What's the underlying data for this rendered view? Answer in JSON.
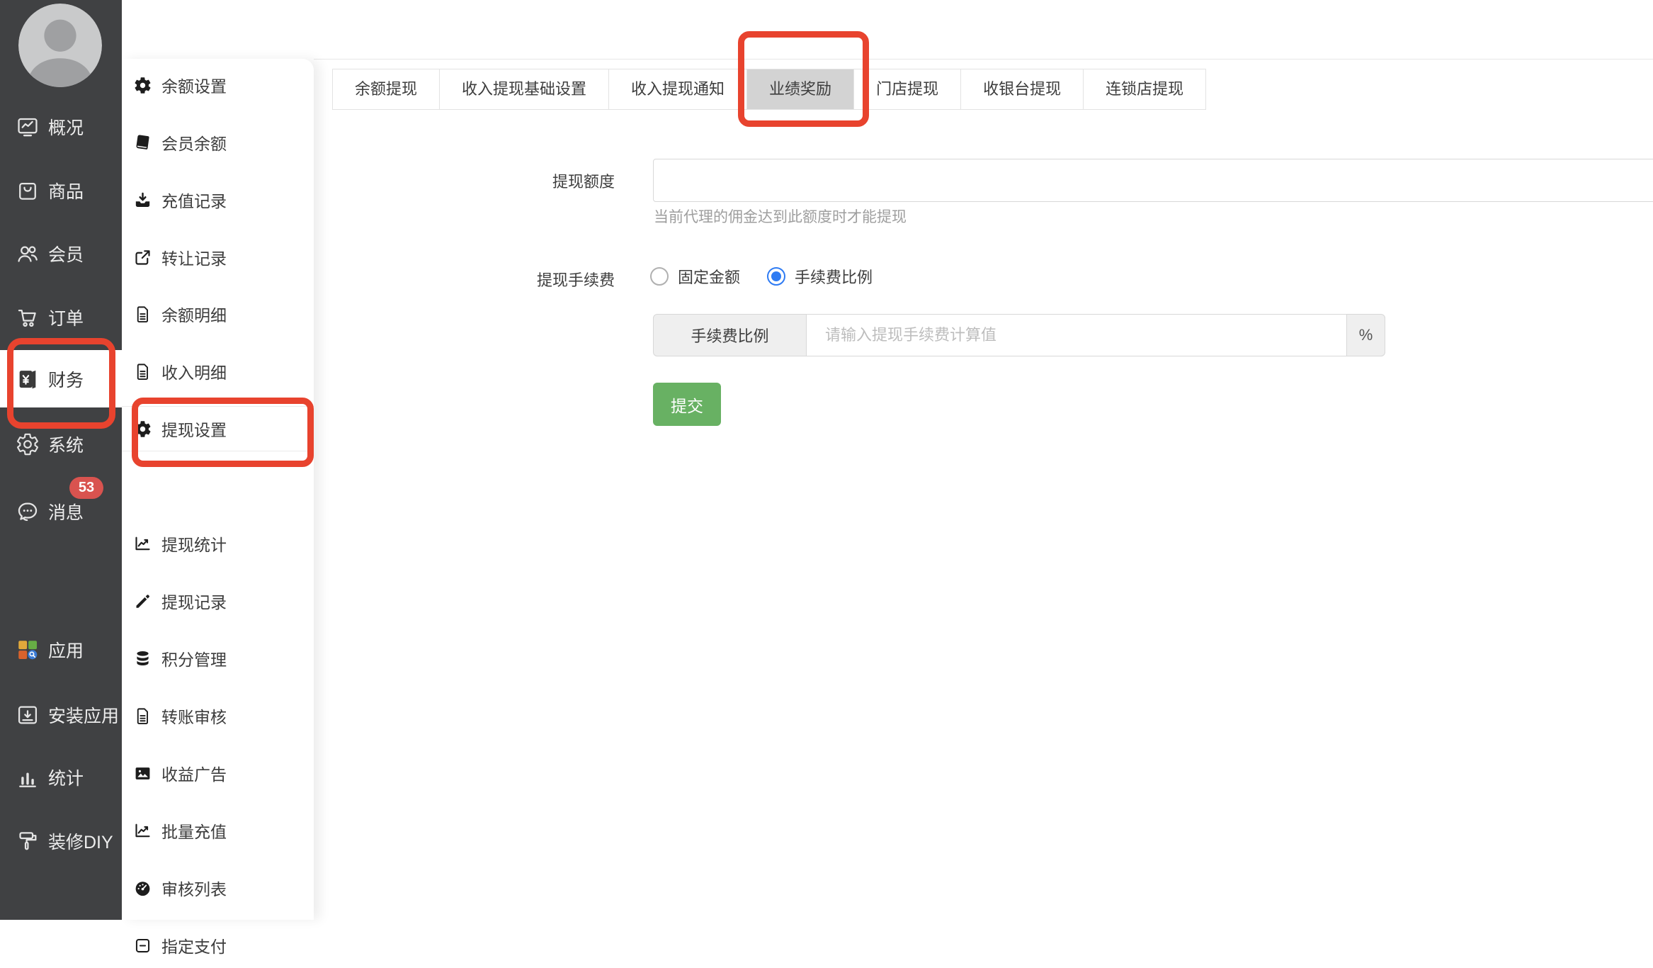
{
  "primary_sidebar": {
    "items": [
      {
        "label": "概况"
      },
      {
        "label": "商品"
      },
      {
        "label": "会员"
      },
      {
        "label": "订单"
      },
      {
        "label": "财务"
      },
      {
        "label": "系统"
      },
      {
        "label": "消息",
        "badge": "53"
      },
      {
        "label": "应用"
      },
      {
        "label": "安装应用"
      },
      {
        "label": "统计"
      },
      {
        "label": "装修DIY"
      }
    ]
  },
  "secondary_sidebar": {
    "items": [
      {
        "label": "余额设置"
      },
      {
        "label": "会员余额"
      },
      {
        "label": "充值记录"
      },
      {
        "label": "转让记录"
      },
      {
        "label": "余额明细"
      },
      {
        "label": "收入明细"
      },
      {
        "label": "提现设置"
      },
      {
        "label": "提现统计"
      },
      {
        "label": "提现记录"
      },
      {
        "label": "积分管理"
      },
      {
        "label": "转账审核"
      },
      {
        "label": "收益广告"
      },
      {
        "label": "批量充值"
      },
      {
        "label": "审核列表"
      },
      {
        "label": "指定支付"
      }
    ]
  },
  "tabs": {
    "items": [
      {
        "label": "余额提现",
        "active": false
      },
      {
        "label": "收入提现基础设置",
        "active": false
      },
      {
        "label": "收入提现通知",
        "active": false
      },
      {
        "label": "业绩奖励",
        "active": true
      },
      {
        "label": "门店提现",
        "active": false
      },
      {
        "label": "收银台提现",
        "active": false
      },
      {
        "label": "连锁店提现",
        "active": false
      }
    ]
  },
  "form": {
    "quota": {
      "label": "提现额度",
      "value": "",
      "helper": "当前代理的佣金达到此额度时才能提现"
    },
    "fee": {
      "label": "提现手续费",
      "options": [
        {
          "label": "固定金额",
          "checked": false
        },
        {
          "label": "手续费比例",
          "checked": true
        }
      ]
    },
    "fee_rate_group": {
      "addon": "手续费比例",
      "placeholder": "请输入提现手续费计算值",
      "suffix": "%"
    },
    "submit_label": "提交"
  },
  "colors": {
    "annotation_red": "#e8432e",
    "badge_red": "#d9534f",
    "radio_blue": "#2e7bf3",
    "submit_green": "#68b163",
    "sidebar_dark": "#404143",
    "active_tab_gray": "#d3d3d3"
  }
}
